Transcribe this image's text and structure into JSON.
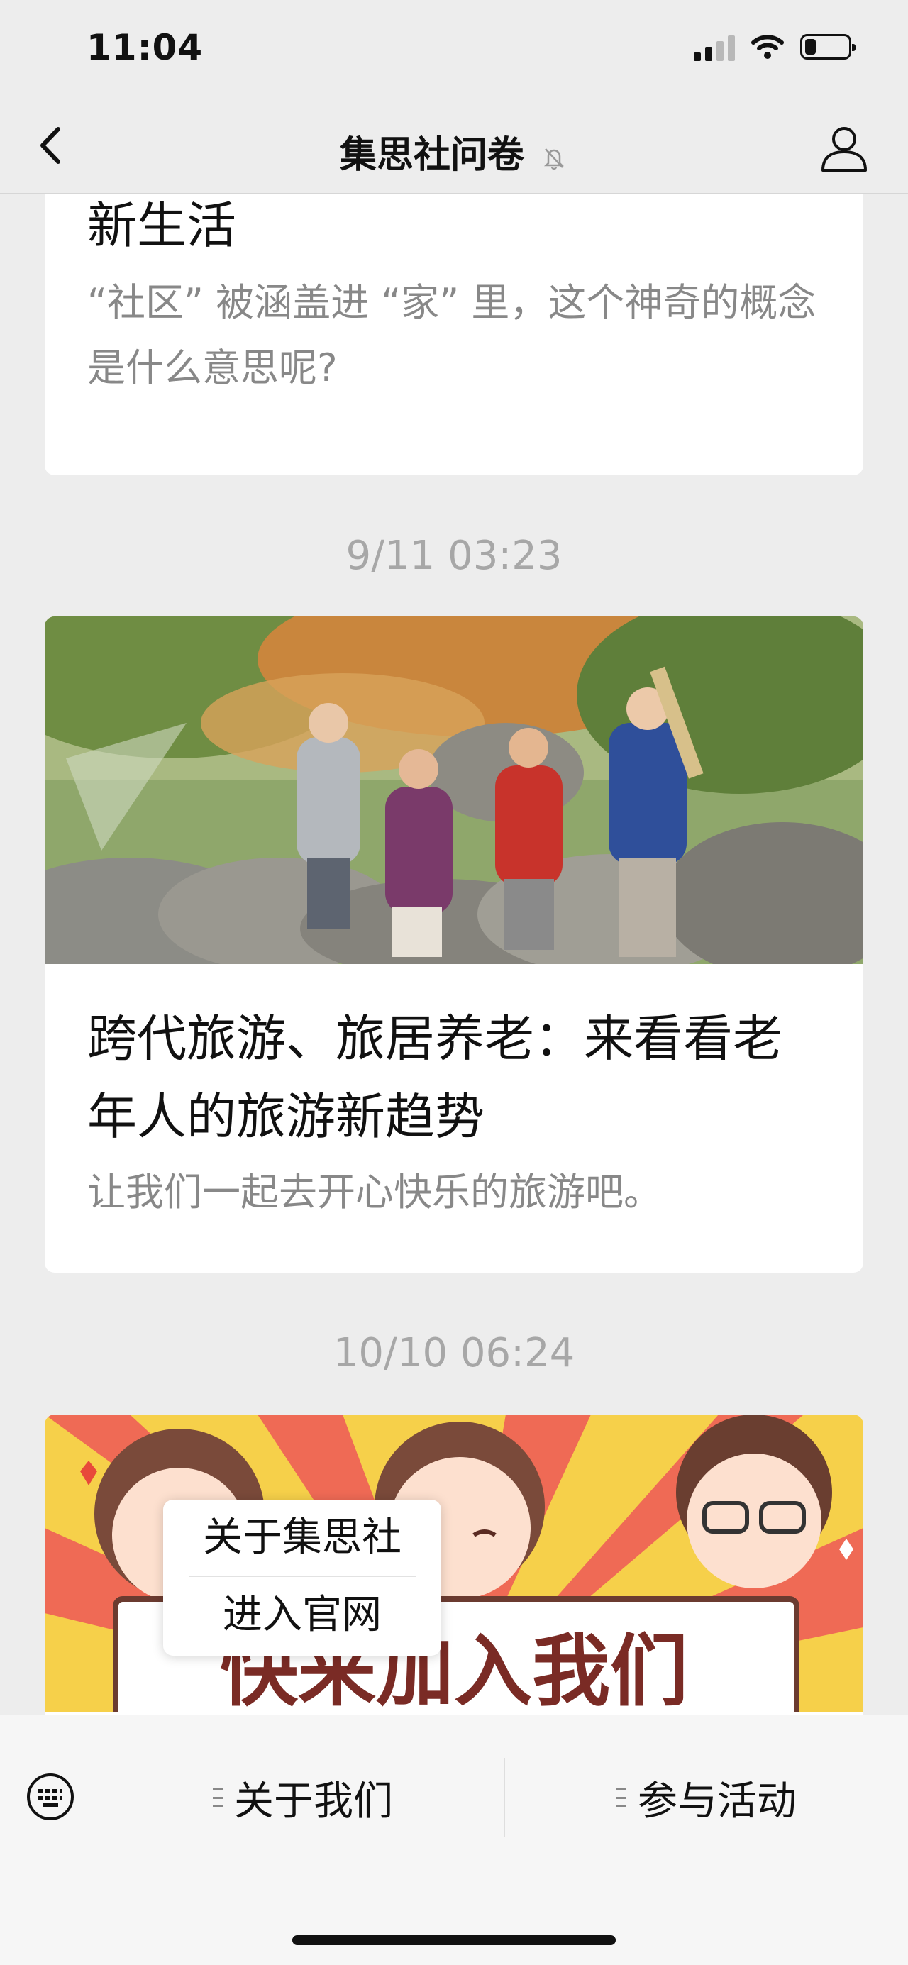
{
  "status_bar": {
    "time": "11:04",
    "battery_level": 0.25
  },
  "nav": {
    "title": "集思社问卷"
  },
  "articles": [
    {
      "title": "新生活",
      "desc": "“社区” 被涵盖进 “家” 里，这个神奇的概念是什么意思呢?"
    },
    {
      "timestamp": "9/11 03:23",
      "title": "跨代旅游、旅居养老：来看看老年人的旅游新趋势",
      "desc": "让我们一起去开心快乐的旅游吧。"
    },
    {
      "timestamp": "10/10 06:24",
      "banner_text": "快来加入我们"
    }
  ],
  "popup_menu": {
    "items": [
      "关于集思社",
      "进入官网"
    ]
  },
  "bottom_menu": {
    "items": [
      "关于我们",
      "参与活动"
    ]
  },
  "colors": {
    "background": "#ededed",
    "card": "#ffffff",
    "muted_text": "#888888",
    "timestamp": "#a7a7a7"
  }
}
